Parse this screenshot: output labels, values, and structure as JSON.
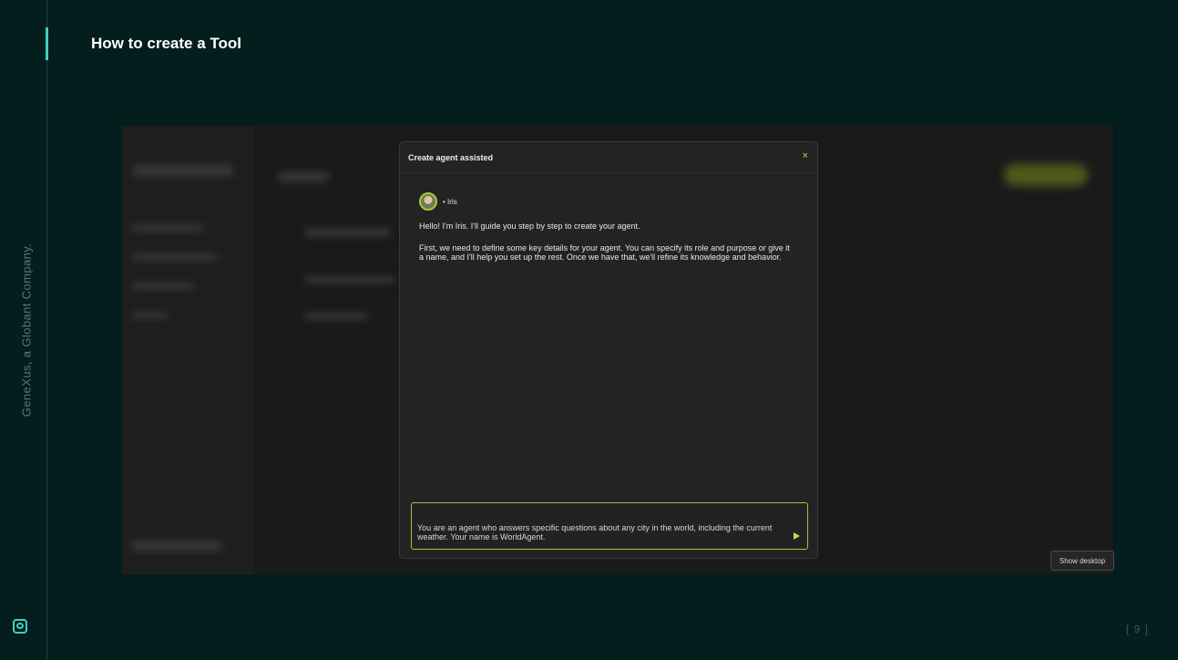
{
  "slide": {
    "title": "How to create a Tool",
    "vertical_brand": "GeneXus, a Globant Company.",
    "page_number": "[ 9 ]",
    "brand_icon": "genexus-logo-icon"
  },
  "modal": {
    "title": "Create agent assisted",
    "close_label": "×",
    "agent_name": "• Iris",
    "messages": [
      "Hello! I'm Iris. I'll guide you step by step to create your agent.",
      "First, we need to define some key details for your agent. You can specify its role and purpose or give it a name, and I'll help you set up the rest. Once we have that, we'll refine its knowledge and behavior."
    ],
    "input_value": "You are an agent who answers specific questions about any city in the world, including the current weather. Your name is WorldAgent.",
    "send_icon": "send-icon"
  },
  "taskbar": {
    "show_desktop_label": "Show desktop"
  },
  "colors": {
    "background": "#041d1d",
    "accent": "#3fd0c0",
    "highlight": "#c7e04a"
  }
}
